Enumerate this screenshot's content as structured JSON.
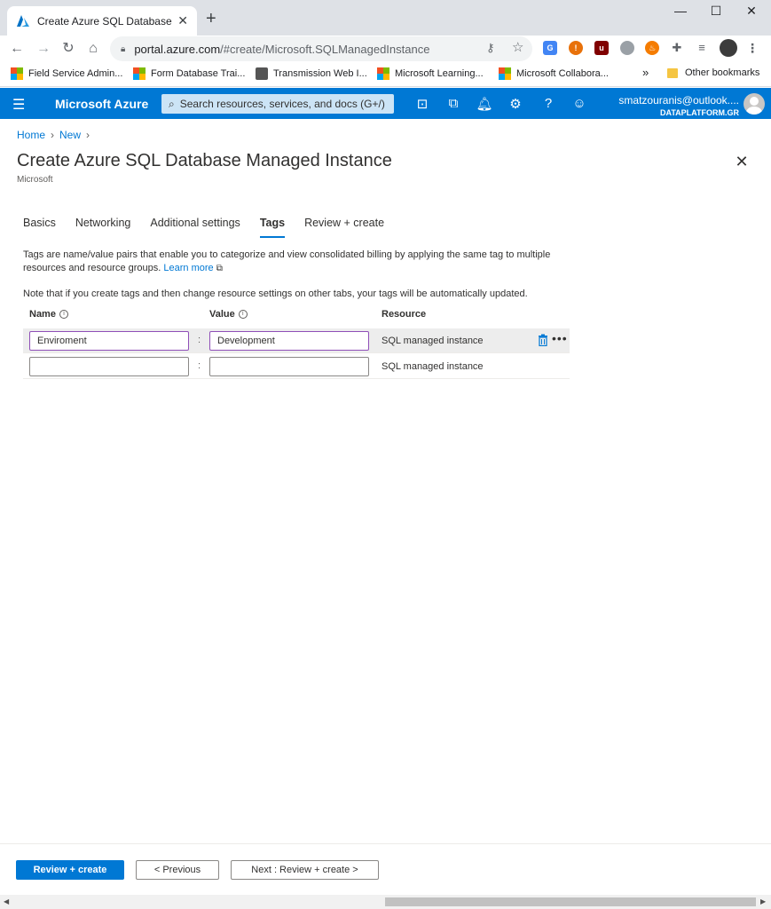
{
  "browser": {
    "tab_title": "Create Azure SQL Database Managed Instance",
    "tab_close": "✕",
    "new_tab": "+",
    "url_host": "portal.azure.com",
    "url_path": "/#create/Microsoft.SQLManagedInstance",
    "bookmarks": [
      {
        "label": "Field Service Admin..."
      },
      {
        "label": "Form Database Trai..."
      },
      {
        "label": "Transmission Web I..."
      },
      {
        "label": "Microsoft Learning..."
      },
      {
        "label": "Microsoft Collabora..."
      }
    ],
    "bookmarks_overflow": "»",
    "other_bookmarks": "Other bookmarks"
  },
  "azure": {
    "brand": "Microsoft Azure",
    "search_placeholder": "Search resources, services, and docs (G+/)",
    "account_email": "smatzouranis@outlook....",
    "account_directory": "DATAPLATFORM.GR"
  },
  "page": {
    "breadcrumb": [
      "Home",
      "New"
    ],
    "title": "Create Azure SQL Database Managed Instance",
    "publisher": "Microsoft",
    "tabs": [
      "Basics",
      "Networking",
      "Additional settings",
      "Tags",
      "Review + create"
    ],
    "active_tab": "Tags",
    "description": "Tags are name/value pairs that enable you to categorize and view consolidated billing by applying the same tag to multiple resources and resource groups.",
    "learn_more": "Learn more",
    "note": "Note that if you create tags and then change resource settings on other tabs, your tags will be automatically updated.",
    "columns": {
      "name": "Name",
      "value": "Value",
      "resource": "Resource"
    },
    "rows": [
      {
        "name": "Enviroment",
        "value": "Development",
        "resource": "SQL managed instance"
      },
      {
        "name": "",
        "value": "",
        "resource": "SQL managed instance"
      }
    ],
    "separator": ":"
  },
  "footer": {
    "review_create": "Review + create",
    "previous": "< Previous",
    "next": "Next : Review + create >"
  }
}
